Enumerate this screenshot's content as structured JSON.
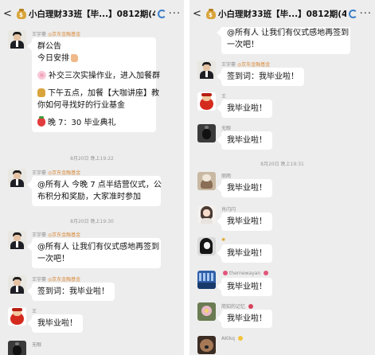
{
  "header": {
    "back_glyph": "<",
    "title": "小白理财33班【毕...】0812期(49)",
    "more_glyph": "···"
  },
  "identities": {
    "teacher": "王宇豪",
    "teacher_org": "◎京东金融基金",
    "user_wang": "王",
    "user_wuyuan": "无眼",
    "user_liyu": "丽雨",
    "user_xiaoqiao": "肖闪闪",
    "user_sun": "✺",
    "user_therne": "thernewayan",
    "user_jianjun": "简知的记忆",
    "user_akkq": "AKikq"
  },
  "left": {
    "announcement": {
      "l1": "群公告",
      "l2": "今日安排",
      "l3": "补交三次实操作业，进入加餐群",
      "l4": "下午五点，加餐【大咖讲座】教",
      "l5": "你如何寻找好的行业基金",
      "l6": "晚 7：30 毕业典礼"
    },
    "ts1": "8月20日 晚上19:22",
    "notice": {
      "l1": "@所有人 今晚 7 点半结营仪式，公",
      "l2": "布积分和奖励，大家准时参加"
    },
    "ts2": "8月20日 晚上19:30",
    "ceremony": {
      "l1": "@所有人 让我们有仪式感地再签到",
      "l2": "一次吧！"
    },
    "signin": "签到词：我毕业啦！",
    "reply1": "我毕业啦！"
  },
  "right": {
    "ceremony": {
      "l1": "@所有人 让我们有仪式感地再签到",
      "l2": "一次吧！"
    },
    "signin": "签到词：我毕业啦！",
    "reply1": "我毕业啦！",
    "reply2": "我毕业啦！",
    "ts1": "8月20日 晚上19:31",
    "reply3": "我毕业啦！",
    "reply4": "我毕业啦！",
    "reply5": "我毕业啦！",
    "reply6": "我毕业啦！",
    "reply7": "我毕业啦！"
  },
  "colors": {
    "background": "#ededed",
    "bubble": "#ffffff",
    "org_tag": "#d98a3a",
    "refresh_icon": "#3d7ec8"
  }
}
